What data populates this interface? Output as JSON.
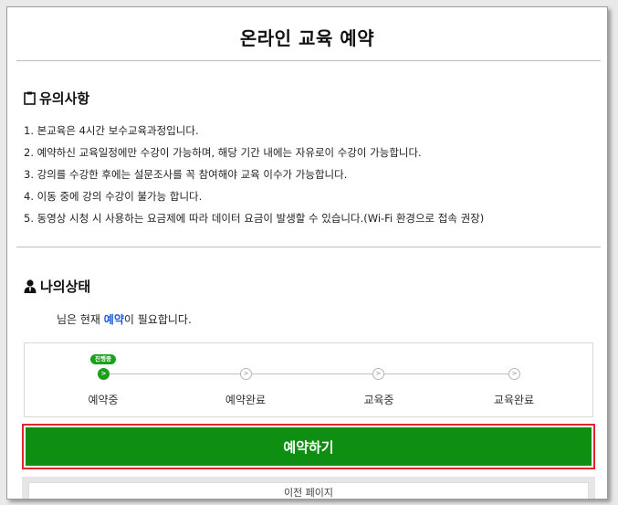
{
  "page": {
    "title": "온라인 교육 예약"
  },
  "notice": {
    "heading": "유의사항",
    "icon": "clipboard-icon",
    "items": [
      "1. 본교육은 4시간 보수교육과정입니다.",
      "2. 예약하신 교육일정에만 수강이 가능하며, 해당 기간 내에는 자유로이 수강이 가능합니다.",
      "3. 강의를 수강한 후에는 설문조사를 꼭 참여해야 교육 이수가 가능합니다.",
      "4. 이동 중에 강의 수강이 불가능 합니다.",
      "5. 동영상 시청 시 사용하는 요금제에 따라 데이터 요금이 발생할 수 있습니다.(Wi-Fi 환경으로 접속 권장)"
    ]
  },
  "status": {
    "heading": "나의상태",
    "icon": "user-icon",
    "line_prefix": "님은 현재 ",
    "line_accent": "예약",
    "line_suffix": "이 필요합니다.",
    "accent_color": "#1f5bd6"
  },
  "progress": {
    "badge": "진행중",
    "current_step": 0,
    "steps": [
      "예약중",
      "예약완료",
      "교육중",
      "교육완료"
    ],
    "active_color": "#1aa01a"
  },
  "actions": {
    "reserve_label": "예약하기",
    "reserve_color": "#0f8f12",
    "highlight_color": "#e0262b",
    "prev_label": "이전 페이지"
  }
}
